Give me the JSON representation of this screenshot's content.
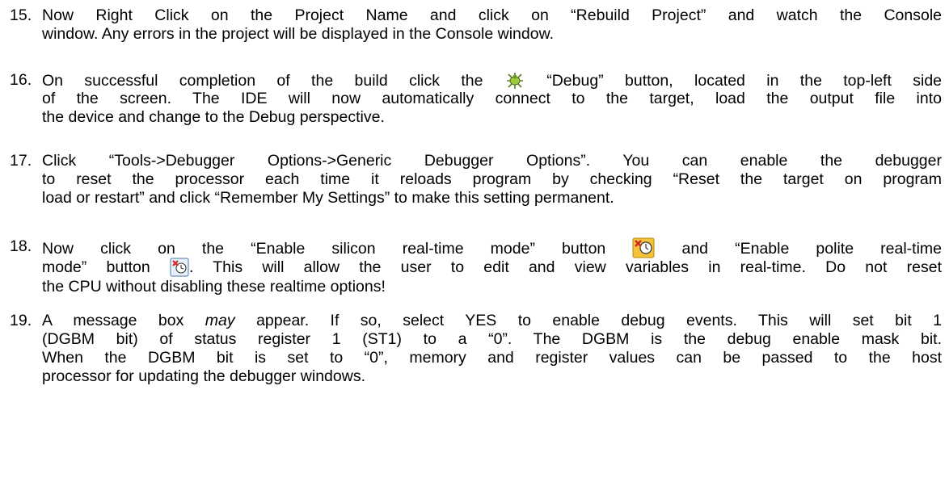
{
  "steps": [
    {
      "number": "15.",
      "lines": [
        "Now Right Click on the Project Name and click on “Rebuild Project” and watch the Console",
        "window. Any errors in the project will be displayed in the Console window."
      ]
    },
    {
      "number": "16.",
      "line1_before_icon": "On successful completion of the build click the",
      "line1_after_icon": "“Debug” button, located in the top-left side",
      "lines": [
        "of the screen. The IDE will now automatically connect to the target, load the output file into",
        "the device and change to the Debug perspective."
      ],
      "icon": "debug-bug-icon"
    },
    {
      "number": "17.",
      "lines": [
        "Click “Tools->Debugger Options->Generic Debugger Options”. You can enable the debugger",
        "to reset the processor each time it reloads program by checking “Reset the target on program",
        "load or restart” and click “Remember My Settings” to make this setting permanent."
      ]
    },
    {
      "number": "18.",
      "line1_before_icon": "Now click on the “Enable silicon real-time mode” button",
      "line1_after_icon": "and “Enable polite real-time",
      "line2_before_icon": "mode” button",
      "line2_after_icon": ". This will allow the user to edit and view variables in real-time. Do not reset",
      "lines": [
        "the CPU without disabling these realtime options!"
      ],
      "icons": [
        "silicon-realtime-icon",
        "polite-realtime-icon"
      ]
    },
    {
      "number": "19.",
      "line1_a": "A message box",
      "line1_em": "may",
      "line1_b": "appear. If so, select YES to enable debug events. This will set bit 1",
      "lines": [
        "(DGBM bit) of status register 1 (ST1) to a “0”. The DGBM is the debug enable mask bit.",
        "When the DGBM bit is set to “0”, memory and register values can be passed to the host",
        "processor for updating the debugger windows."
      ]
    }
  ]
}
